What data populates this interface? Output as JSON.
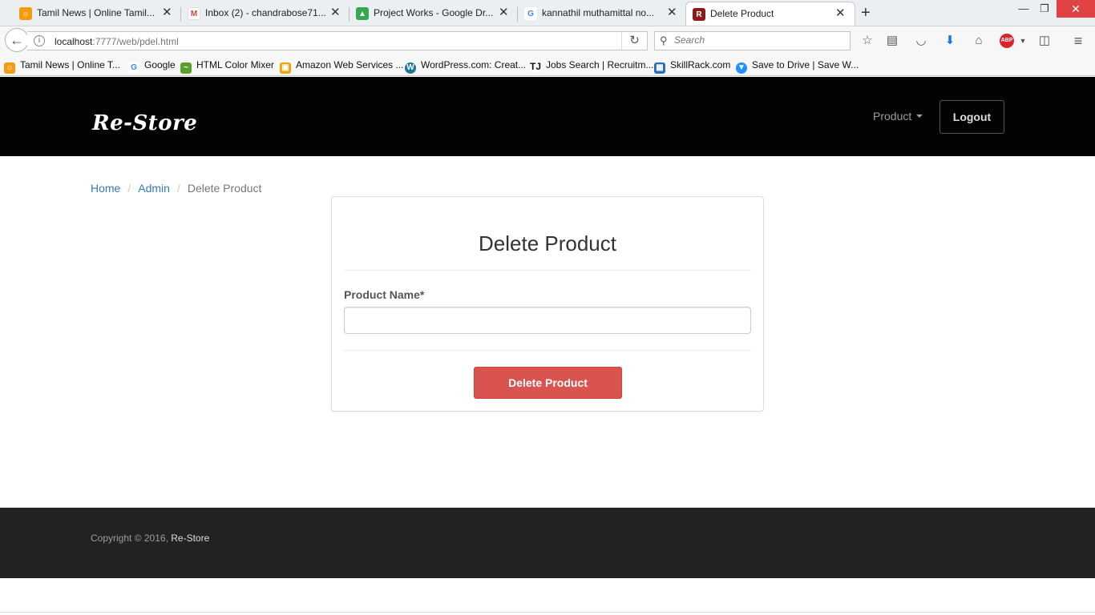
{
  "browser": {
    "tabs": [
      {
        "title": "Tamil News | Online Tamil...",
        "favicon": "sun-icon",
        "favicon_color": "#f39c12"
      },
      {
        "title": "Inbox (2) - chandrabose71...",
        "favicon": "gmail-icon",
        "favicon_color": "#d14836"
      },
      {
        "title": "Project Works - Google Dr...",
        "favicon": "drive-icon",
        "favicon_color": "#34a853"
      },
      {
        "title": "kannathil muthamittal no...",
        "favicon": "google-icon",
        "favicon_color": "#4285f4"
      },
      {
        "title": "Delete Product",
        "favicon": "restore-icon",
        "favicon_color": "#8b1a1a"
      }
    ],
    "url_host": "localhost",
    "url_rest": ":7777/web/pdel.html",
    "search_placeholder": "Search",
    "bookmarks": [
      {
        "label": "Tamil News | Online T...",
        "icon": "sun-icon",
        "color": "#f39c12"
      },
      {
        "label": "Google",
        "icon": "google-icon",
        "color": "#4285f4"
      },
      {
        "label": "HTML Color Mixer",
        "icon": "color-mixer-icon",
        "color": "#5aa02c"
      },
      {
        "label": "Amazon Web Services ...",
        "icon": "box-icon",
        "color": "#f0a30a"
      },
      {
        "label": "WordPress.com: Creat...",
        "icon": "wordpress-icon",
        "color": "#21759b"
      },
      {
        "label": "Jobs Search | Recruitm...",
        "icon": "tj-icon",
        "color": "#c0392b"
      },
      {
        "label": "SkillRack.com",
        "icon": "skillrack-icon",
        "color": "#2a6ebb"
      },
      {
        "label": "Save to Drive | Save W...",
        "icon": "save-drive-icon",
        "color": "#1e90ff"
      }
    ]
  },
  "site": {
    "brand": "Re-Store",
    "nav_product": "Product",
    "logout": "Logout"
  },
  "breadcrumb": {
    "home": "Home",
    "admin": "Admin",
    "current": "Delete Product"
  },
  "form": {
    "title": "Delete Product",
    "product_name_label": "Product Name*",
    "product_name_value": "",
    "submit": "Delete Product"
  },
  "footer": {
    "copyright": "Copyright © 2016, ",
    "brand": "Re-Store"
  },
  "colors": {
    "header_bg": "#030303",
    "footer_bg": "#222222",
    "danger": "#d9534f",
    "link": "#337ab7"
  }
}
